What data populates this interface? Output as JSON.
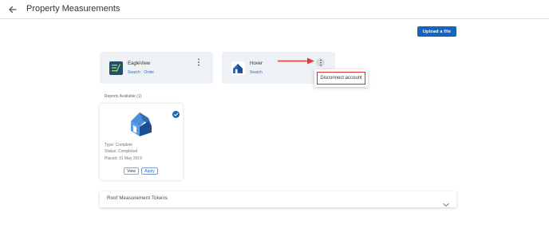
{
  "header": {
    "title": "Property Measurements",
    "back_icon": "arrow-left-icon"
  },
  "toolbar": {
    "upload_label": "Upload a file",
    "accent_color": "#1565c0"
  },
  "providers": [
    {
      "name": "EagleView",
      "links": [
        "Search",
        "Order"
      ],
      "link_separator": "·",
      "logo_icon": "eagleview-logo-icon"
    },
    {
      "name": "Hover",
      "links": [
        "Search"
      ],
      "logo_icon": "hover-logo-icon"
    }
  ],
  "menu": {
    "disconnect_label": "Disconnect account",
    "highlight_color": "#d32f2f"
  },
  "reports": {
    "heading": "Reports Available (1)",
    "items": [
      {
        "type": "Type: Complete",
        "status": "Status: Completed",
        "placed": "Placed: 31 May 2019",
        "view_label": "View",
        "apply_label": "Apply",
        "selected": true
      }
    ]
  },
  "tokens": {
    "title": "Roof Measurement Tokens",
    "expanded": false
  }
}
